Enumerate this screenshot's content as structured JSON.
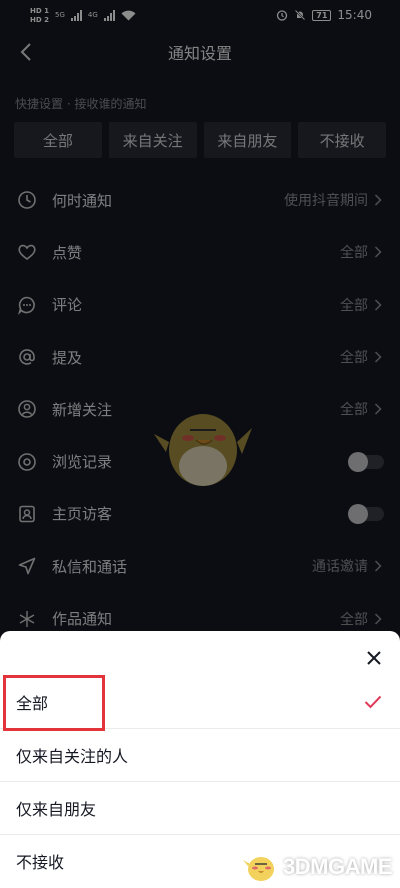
{
  "status_bar": {
    "sim1": "HD 1",
    "sim2": "HD 2",
    "net1": "5G",
    "net2": "4G",
    "battery": "71",
    "time": "15:40"
  },
  "header": {
    "title": "通知设置",
    "back_icon": "chevron-left-icon"
  },
  "quick": {
    "caption": "快捷设置 · 接收谁的通知",
    "buttons": [
      "全部",
      "来自关注",
      "来自朋友",
      "不接收"
    ]
  },
  "settings": [
    {
      "label": "何时通知",
      "value": "使用抖音期间",
      "control": "chevron",
      "icon": "clock-icon"
    },
    {
      "label": "点赞",
      "value": "全部",
      "control": "chevron",
      "icon": "heart-icon"
    },
    {
      "label": "评论",
      "value": "全部",
      "control": "chevron",
      "icon": "comment-icon"
    },
    {
      "label": "提及",
      "value": "全部",
      "control": "chevron",
      "icon": "at-icon"
    },
    {
      "label": "新增关注",
      "value": "全部",
      "control": "chevron",
      "icon": "user-icon"
    },
    {
      "label": "浏览记录",
      "value": "",
      "control": "toggle",
      "toggle_on": false,
      "icon": "eye-icon"
    },
    {
      "label": "主页访客",
      "value": "",
      "control": "toggle",
      "toggle_on": false,
      "icon": "profile-icon"
    },
    {
      "label": "私信和通话",
      "value": "通话邀请",
      "control": "chevron",
      "icon": "send-icon"
    },
    {
      "label": "作品通知",
      "value": "全部",
      "control": "chevron",
      "icon": "sparkle-icon"
    }
  ],
  "sheet": {
    "close_icon": "close-icon",
    "options": [
      {
        "label": "全部",
        "selected": true
      },
      {
        "label": "仅来自关注的人",
        "selected": false
      },
      {
        "label": "仅来自朋友",
        "selected": false
      },
      {
        "label": "不接收",
        "selected": false
      }
    ],
    "check_color": "#e0395a"
  },
  "watermark": {
    "text": "3DMGAME"
  },
  "colors": {
    "background": "#161823",
    "quick_button": "#2a2c36",
    "highlight": "#e3343b"
  }
}
